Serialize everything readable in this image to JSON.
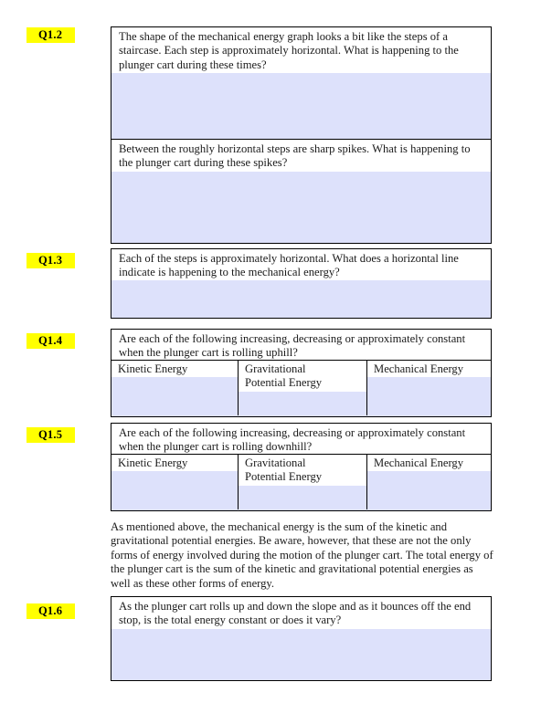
{
  "document": {
    "title": "Plunger cart mechanical energy worksheet",
    "highlight_color": "#ffff00",
    "answer_fill_color": "#dde1fb",
    "border_color": "#000000"
  },
  "questions": [
    {
      "id": "q1-2",
      "label": "Q1.2",
      "prompts": [
        "The shape of the mechanical energy graph looks a bit like the steps of a staircase.  Each step is approximately horizontal.  What is happening to the plunger cart during these times?",
        "Between the roughly horizontal steps are sharp spikes.  What is happening to the plunger cart during these spikes?"
      ]
    },
    {
      "id": "q1-3",
      "label": "Q1.3",
      "prompts": [
        "Each of the steps is approximately horizontal.  What does a horizontal line indicate is happening to the mechanical energy?"
      ]
    },
    {
      "id": "q1-4",
      "label": "Q1.4",
      "prompts": [
        "Are each of the following increasing, decreasing or approximately constant when the plunger cart is rolling uphill?"
      ],
      "columns": [
        "Kinetic Energy",
        "Gravitational\nPotential Energy",
        "Mechanical Energy"
      ],
      "answers": [
        "",
        "",
        ""
      ]
    },
    {
      "id": "q1-5",
      "label": "Q1.5",
      "prompts": [
        "Are each of the following increasing, decreasing or approximately constant when the plunger cart is rolling downhill?"
      ],
      "columns": [
        "Kinetic Energy",
        "Gravitational\nPotential Energy",
        "Mechanical Energy"
      ],
      "answers": [
        "",
        "",
        ""
      ]
    },
    {
      "id": "q1-6",
      "label": "Q1.6",
      "prompts": [
        "As the plunger cart rolls up and down the slope and as it bounces off the end stop, is the total energy constant or does it vary?"
      ]
    }
  ],
  "paragraph": {
    "text": "As mentioned above, the mechanical energy is the sum of the kinetic and gravitational potential energies.  Be aware, however, that these are not the only forms of energy involved during the motion of the plunger cart.  The total energy of the plunger cart is the sum of the kinetic and gravitational potential energies as well as these other forms of energy."
  }
}
